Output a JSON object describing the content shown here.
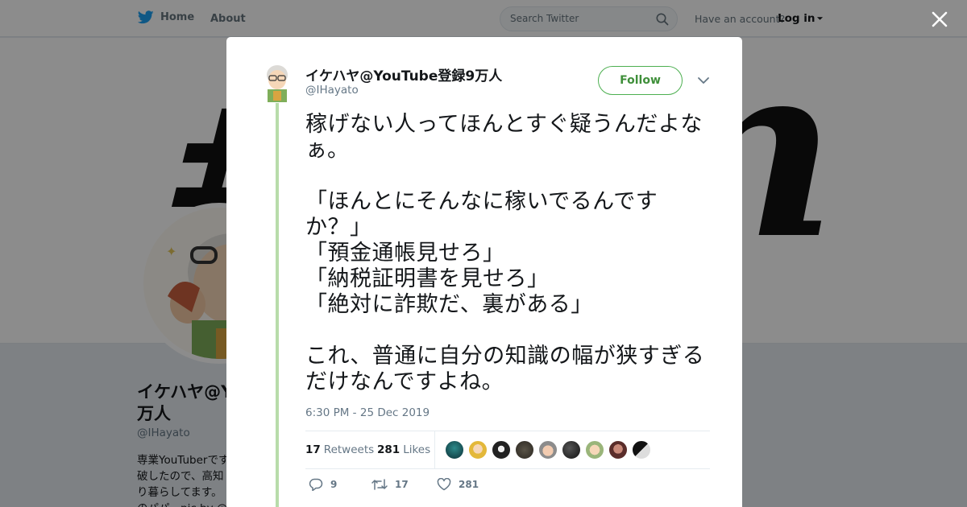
{
  "topbar": {
    "home_label": "Home",
    "about_label": "About",
    "search_placeholder": "Search Twitter",
    "have_account": "Have an account?",
    "login_label": "Log in"
  },
  "profile": {
    "name": "イケハヤ@Y",
    "name_line2": "万人",
    "handle": "@IHayato",
    "bio_lines": [
      "専業YouTuberです",
      "破したので、高知",
      "り暮らしてます。",
      "のパパ。pic by @"
    ]
  },
  "tweet": {
    "author_name": "イケハヤ@YouTube登録9万人",
    "author_handle": "@IHayato",
    "follow_label": "Follow",
    "text": "稼げない人ってほんとすぐ疑うんだよなぁ。\n\n「ほんとにそんなに稼いでるんです\nか？」\n「預金通帳見せろ」\n「納税証明書を見せろ」\n「絶対に詐欺だ、裏がある」\n\nこれ、普通に自分の知識の幅が狭すぎる\nだけなんですよね。",
    "timestamp": "6:30 PM - 25 Dec 2019",
    "retweets_count": "17",
    "retweets_label": "Retweets",
    "likes_count": "281",
    "likes_label": "Likes",
    "actions": {
      "replies": "9",
      "retweets": "17",
      "likes": "281"
    }
  },
  "colors": {
    "twitter_blue": "#1da1f2",
    "follow_green": "#4caf50",
    "thread_line": "#b8dcaa"
  }
}
